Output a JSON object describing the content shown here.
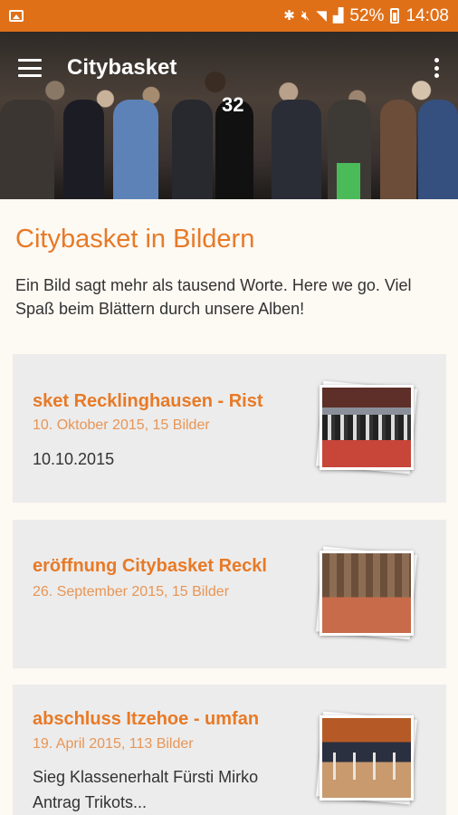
{
  "statusbar": {
    "battery_text": "52%",
    "time": "14:08",
    "icons": [
      "image-notification-icon",
      "bluetooth-icon",
      "mute-icon",
      "wifi-icon",
      "signal-icon",
      "battery-icon"
    ]
  },
  "appbar": {
    "title": "Citybasket"
  },
  "hero": {
    "jersey_number": "32"
  },
  "page": {
    "title": "Citybasket in Bildern",
    "intro": "Ein Bild sagt mehr als tausend Worte. Here we go. Viel Spaß beim Blättern durch unsere Alben!"
  },
  "albums": [
    {
      "title_visible": "sket Recklinghausen - Rist",
      "subtitle": "10. Oktober 2015, 15 Bilder",
      "description": "10.10.2015"
    },
    {
      "title_visible": "eröffnung Citybasket Reckl",
      "subtitle": "26. September 2015, 15 Bilder",
      "description": ""
    },
    {
      "title_visible": "abschluss Itzehoe - umfan",
      "subtitle": "19. April 2015, 113 Bilder",
      "description": "Sieg Klassenerhalt Fürsti Mirko Antrag Trikots..."
    }
  ],
  "colors": {
    "statusbar": "#e07018",
    "accent": "#e77a27",
    "card_bg": "#ececec",
    "page_bg": "#fdf9f3"
  }
}
